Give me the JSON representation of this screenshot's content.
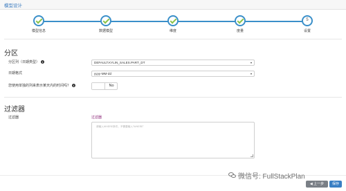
{
  "header": {
    "title": "模型设计"
  },
  "wizard": {
    "steps": [
      {
        "label": "模型信息",
        "state": "done",
        "number": ""
      },
      {
        "label": "数据模型",
        "state": "done",
        "number": ""
      },
      {
        "label": "维度",
        "state": "done",
        "number": ""
      },
      {
        "label": "度量",
        "state": "done",
        "number": ""
      },
      {
        "label": "设置",
        "state": "current",
        "number": "5"
      }
    ]
  },
  "partition": {
    "title": "分区",
    "column_label": "分区列（日期类型）",
    "column_value": "DEFAULT.KYLIN_SALES.PART_DT",
    "format_label": "日期格式",
    "format_value": "yyyy-MM-dd",
    "separate_label": "您使用单独的列来表示某天内的时间吗？",
    "separate_value": "No"
  },
  "filter": {
    "title": "过滤器",
    "label": "过滤器",
    "right_label": "过滤器",
    "placeholder": "请输入WHERE条件，不需要输入\"WHERE\""
  },
  "footer": {
    "prev_label": "上一步",
    "save_label": "保存"
  },
  "watermark": {
    "text": "微信号: FullStackPlan"
  },
  "colors": {
    "accent": "#3a8fc9",
    "check": "#8bc34a",
    "filter_label": "#8e2a7a",
    "save": "#3a7fc4",
    "prev": "#7a7f86"
  }
}
